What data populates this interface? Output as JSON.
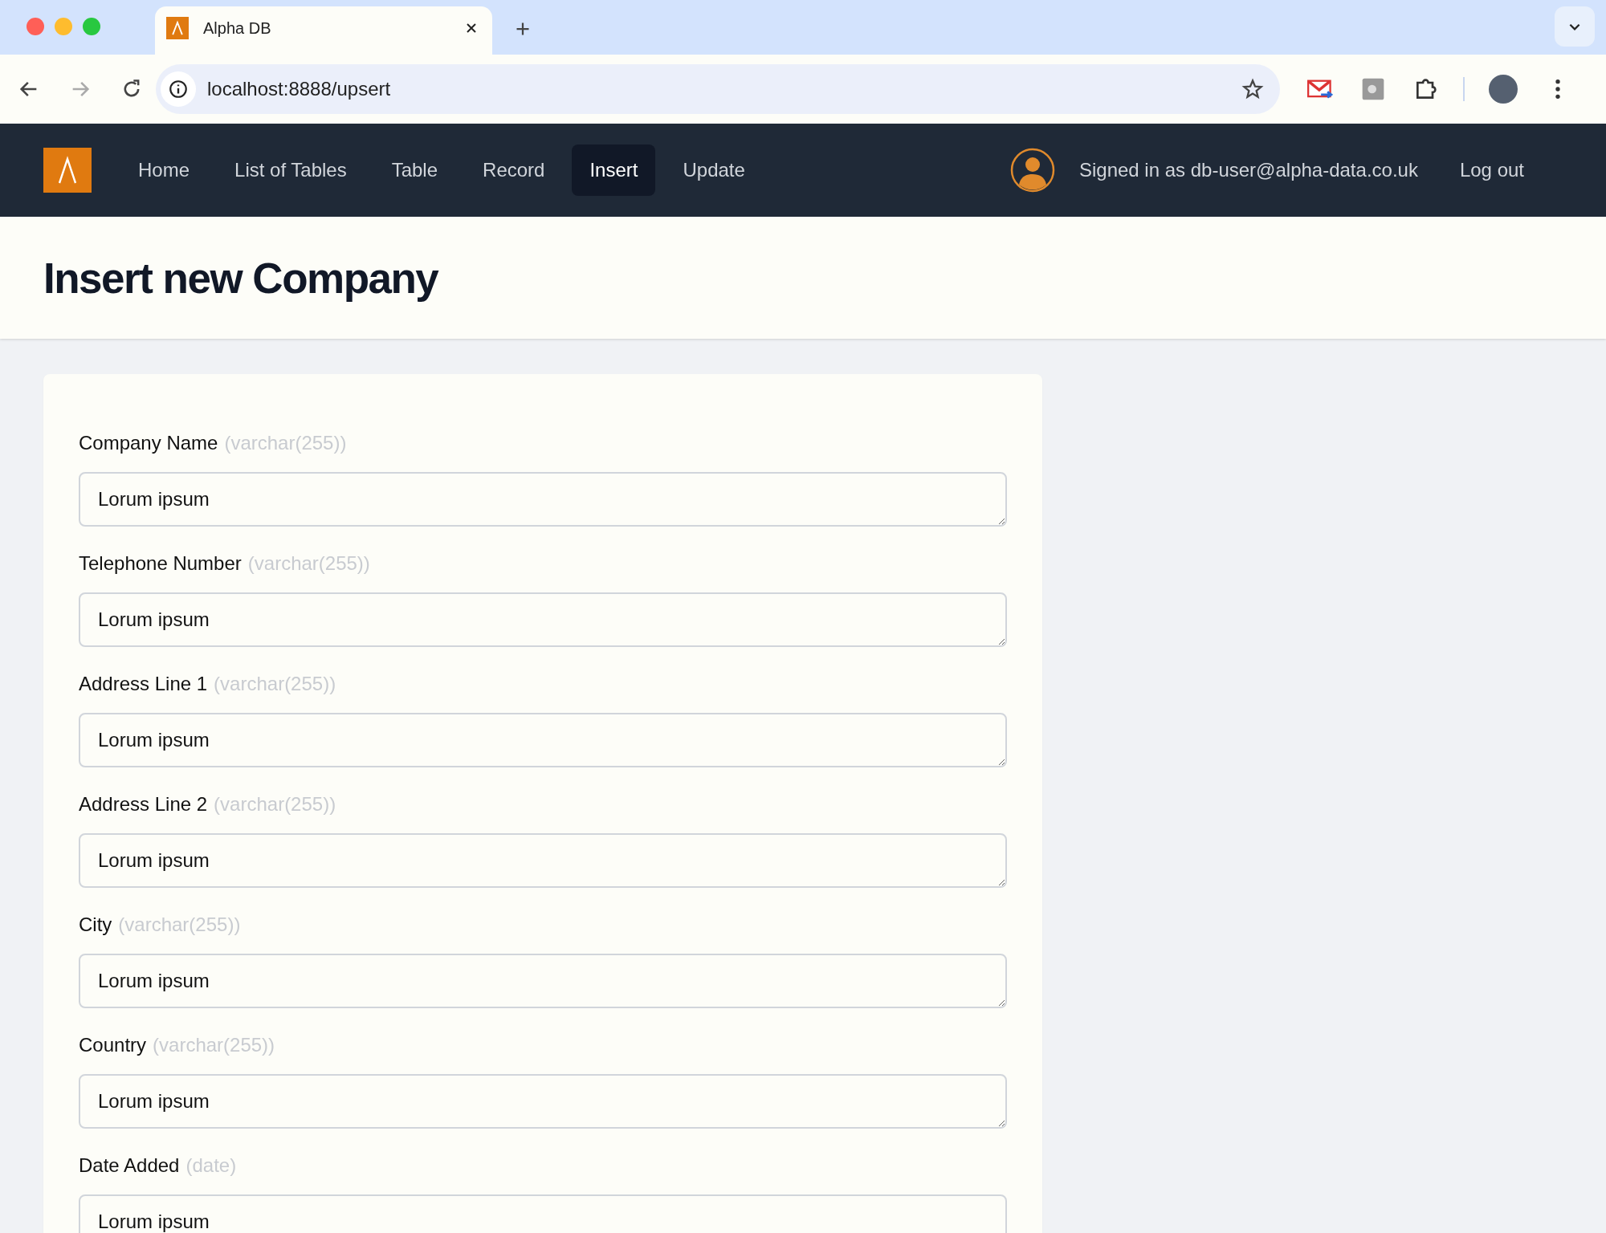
{
  "browser": {
    "tab_title": "Alpha DB",
    "url": "localhost:8888/upsert"
  },
  "nav": {
    "items": [
      {
        "label": "Home",
        "selected": false
      },
      {
        "label": "List of Tables",
        "selected": false
      },
      {
        "label": "Table",
        "selected": false
      },
      {
        "label": "Record",
        "selected": false
      },
      {
        "label": "Insert",
        "selected": true
      },
      {
        "label": "Update",
        "selected": false
      }
    ],
    "signed_in": "Signed in as db-user@alpha-data.co.uk",
    "logout": "Log out"
  },
  "page_title": "Insert new Company",
  "fields": [
    {
      "label": "Company Name",
      "type": "(varchar(255))",
      "value": "Lorum ipsum"
    },
    {
      "label": "Telephone Number",
      "type": "(varchar(255))",
      "value": "Lorum ipsum"
    },
    {
      "label": "Address Line 1",
      "type": "(varchar(255))",
      "value": "Lorum ipsum"
    },
    {
      "label": "Address Line 2",
      "type": "(varchar(255))",
      "value": "Lorum ipsum"
    },
    {
      "label": "City",
      "type": "(varchar(255))",
      "value": "Lorum ipsum"
    },
    {
      "label": "Country",
      "type": "(varchar(255))",
      "value": "Lorum ipsum"
    },
    {
      "label": "Date Added",
      "type": "(date)",
      "value": "Lorum ipsum"
    }
  ]
}
